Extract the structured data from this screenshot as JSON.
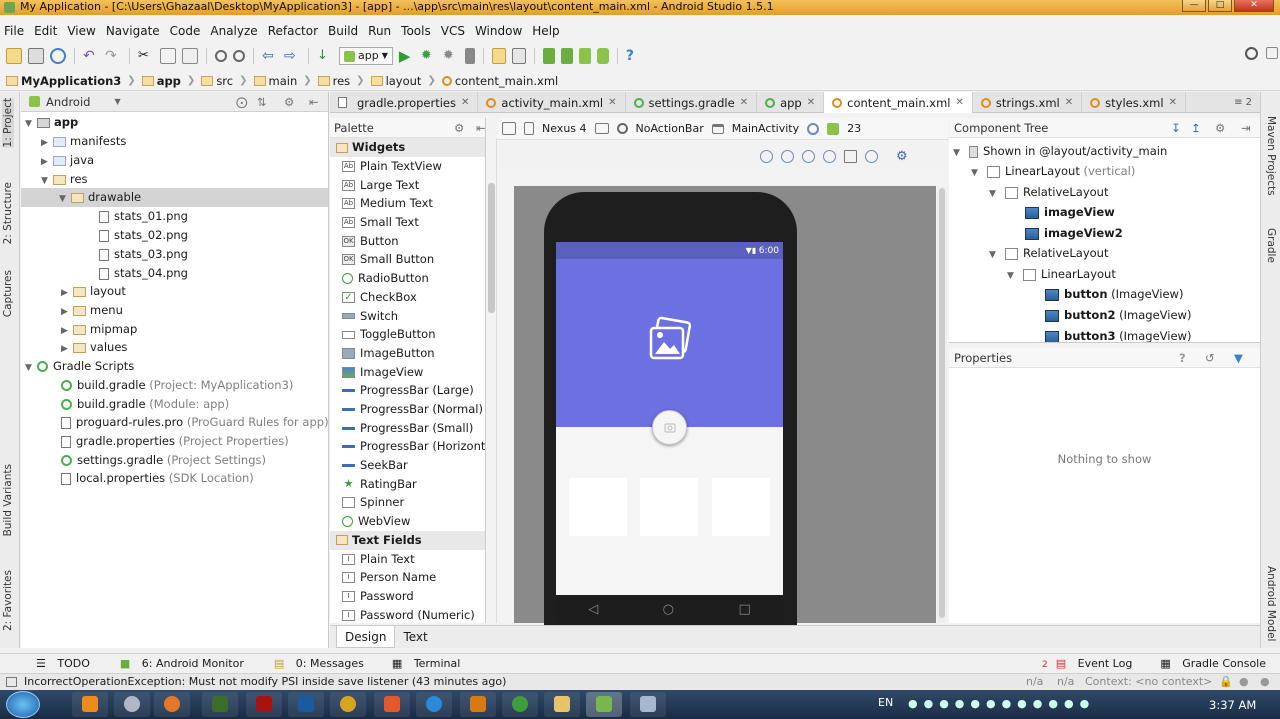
{
  "window": {
    "title": "My Application - [C:\\Users\\Ghazaal\\Desktop\\MyApplication3] - [app] - ...\\app\\src\\main\\res\\layout\\content_main.xml - Android Studio 1.5.1"
  },
  "menu": [
    "File",
    "Edit",
    "View",
    "Navigate",
    "Code",
    "Analyze",
    "Refactor",
    "Build",
    "Run",
    "Tools",
    "VCS",
    "Window",
    "Help"
  ],
  "toolbar": {
    "run_config": "app"
  },
  "breadcrumb": [
    "MyApplication3",
    "app",
    "src",
    "main",
    "res",
    "layout",
    "content_main.xml"
  ],
  "left_strip": [
    "1: Project",
    "2: Structure",
    "Captures",
    "Build Variants",
    "2: Favorites"
  ],
  "right_strip": [
    "Maven Projects",
    "Gradle",
    "Android Model"
  ],
  "project": {
    "view_selector": "Android",
    "tree": [
      {
        "label": "app",
        "bold": true
      },
      {
        "label": "manifests"
      },
      {
        "label": "java"
      },
      {
        "label": "res"
      },
      {
        "label": "drawable",
        "selected": true
      },
      {
        "label": "stats_01.png"
      },
      {
        "label": "stats_02.png"
      },
      {
        "label": "stats_03.png"
      },
      {
        "label": "stats_04.png"
      },
      {
        "label": "layout"
      },
      {
        "label": "menu"
      },
      {
        "label": "mipmap"
      },
      {
        "label": "values"
      },
      {
        "label": "Gradle Scripts"
      },
      {
        "label": "build.gradle",
        "note": "(Project: MyApplication3)"
      },
      {
        "label": "build.gradle",
        "note": "(Module: app)"
      },
      {
        "label": "proguard-rules.pro",
        "note": "(ProGuard Rules for app)"
      },
      {
        "label": "gradle.properties",
        "note": "(Project Properties)"
      },
      {
        "label": "settings.gradle",
        "note": "(Project Settings)"
      },
      {
        "label": "local.properties",
        "note": "(SDK Location)"
      }
    ]
  },
  "editor_tabs": [
    "gradle.properties",
    "activity_main.xml",
    "settings.gradle",
    "app",
    "content_main.xml",
    "strings.xml",
    "styles.xml"
  ],
  "editor_tabs_overflow": "≡ 2",
  "palette": {
    "title": "Palette",
    "sections": [
      {
        "name": "Widgets",
        "items": [
          "Plain TextView",
          "Large Text",
          "Medium Text",
          "Small Text",
          "Button",
          "Small Button",
          "RadioButton",
          "CheckBox",
          "Switch",
          "ToggleButton",
          "ImageButton",
          "ImageView",
          "ProgressBar (Large)",
          "ProgressBar (Normal)",
          "ProgressBar (Small)",
          "ProgressBar (Horizontal)",
          "SeekBar",
          "RatingBar",
          "Spinner",
          "WebView"
        ]
      },
      {
        "name": "Text Fields",
        "items": [
          "Plain Text",
          "Person Name",
          "Password",
          "Password (Numeric)"
        ]
      }
    ]
  },
  "design_toolbar": {
    "device": "Nexus 4",
    "theme": "NoActionBar",
    "activity": "MainActivity",
    "api": "23"
  },
  "phone": {
    "time": "6:00"
  },
  "component_tree": {
    "title": "Component Tree",
    "rows": [
      {
        "label": "Shown in @layout/activity_main",
        "note": ""
      },
      {
        "label": "LinearLayout",
        "note": "(vertical)"
      },
      {
        "label": "RelativeLayout",
        "note": ""
      },
      {
        "label": "imageView",
        "note": ""
      },
      {
        "label": "imageView2",
        "note": ""
      },
      {
        "label": "RelativeLayout",
        "note": ""
      },
      {
        "label": "LinearLayout",
        "note": ""
      },
      {
        "label": "button",
        "note": "(ImageView)"
      },
      {
        "label": "button2",
        "note": "(ImageView)"
      },
      {
        "label": "button3",
        "note": "(ImageView)"
      }
    ]
  },
  "properties": {
    "title": "Properties",
    "empty": "Nothing to show"
  },
  "design_tabs": [
    "Design",
    "Text"
  ],
  "bottom_tools": {
    "todo": "TODO",
    "android_monitor": "6: Android Monitor",
    "messages": "0: Messages",
    "terminal": "Terminal",
    "event_log": "Event Log",
    "event_log_count": "2",
    "gradle_console": "Gradle Console"
  },
  "status": {
    "message": "IncorrectOperationException: Must not modify PSI inside save listener (43 minutes ago)",
    "na1": "n/a",
    "na2": "n/a",
    "context": "Context: <no context>"
  },
  "taskbar": {
    "lang": "EN",
    "clock": "3:37 AM"
  },
  "colors": {
    "accent": "#6c70e0",
    "statusbar": "#5b5fbe",
    "titlebar": "#e39d2d"
  }
}
